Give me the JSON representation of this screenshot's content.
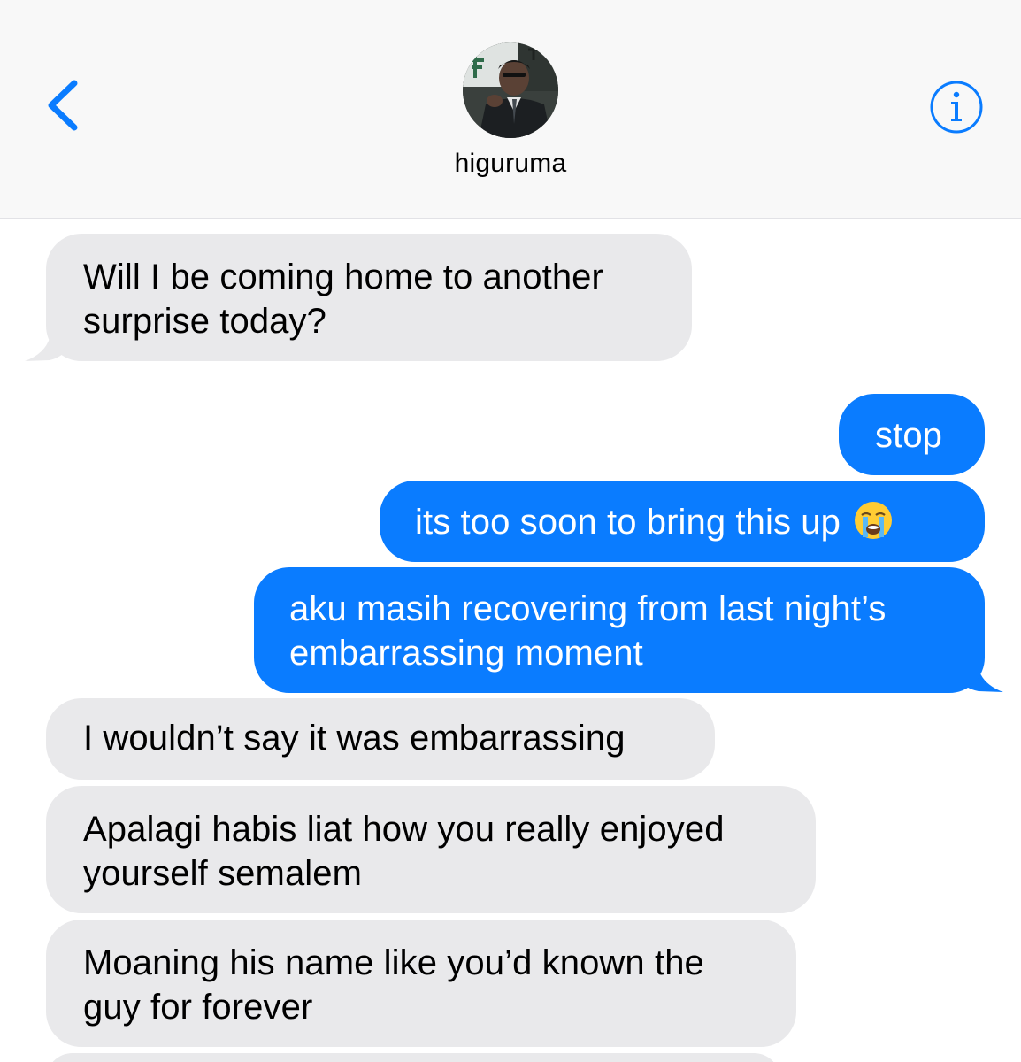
{
  "header": {
    "contact_name": "higuruma",
    "back_icon": "chevron-left-icon",
    "info_icon": "info-icon",
    "accent_color": "#0a7cff"
  },
  "messages": [
    {
      "direction": "incoming",
      "lines": [
        "Will I be coming home to another",
        "surprise today?"
      ]
    },
    {
      "direction": "outgoing",
      "lines": [
        "stop"
      ]
    },
    {
      "direction": "outgoing",
      "lines": [
        "its too soon to bring this up"
      ],
      "emoji": "loudly-crying-face-icon"
    },
    {
      "direction": "outgoing",
      "lines": [
        "aku masih recovering from last night’s",
        "embarrassing moment"
      ]
    },
    {
      "direction": "incoming",
      "lines": [
        "I wouldn’t say it was embarrassing"
      ]
    },
    {
      "direction": "incoming",
      "lines": [
        "Apalagi habis liat how you really enjoyed",
        "yourself semalem"
      ]
    },
    {
      "direction": "incoming",
      "lines": [
        "Moaning his name like you’d known the",
        "guy for forever"
      ]
    }
  ],
  "colors": {
    "incoming_bubble": "#e9e9eb",
    "outgoing_bubble": "#0a7cff",
    "header_background": "#f8f8f8"
  }
}
